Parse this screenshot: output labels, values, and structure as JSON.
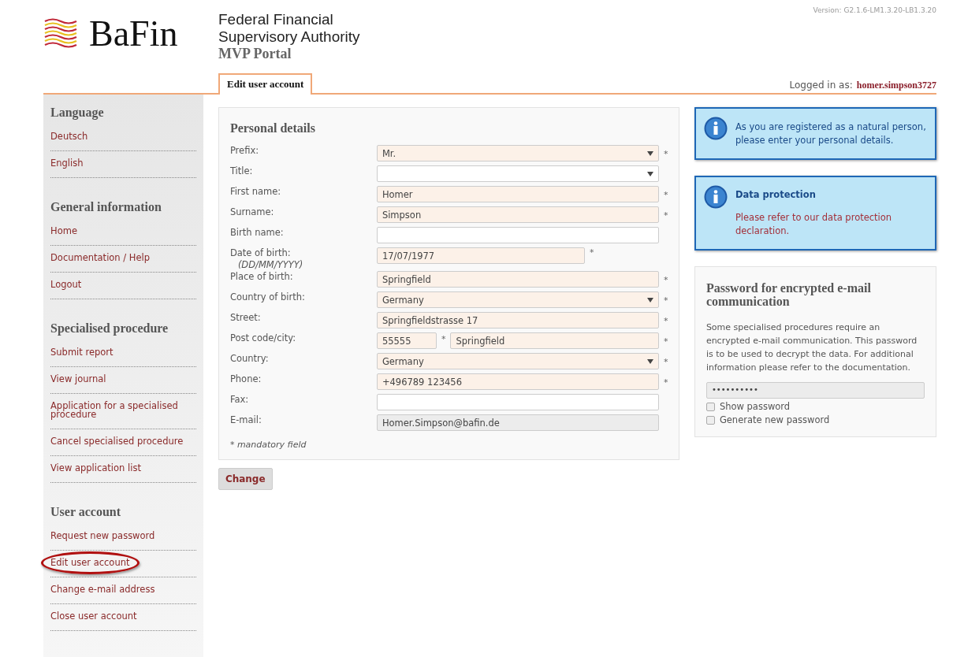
{
  "header": {
    "brand": "BaFin",
    "org_lines": [
      "Federal Financial",
      "Supervisory Authority"
    ],
    "portal": "MVP Portal",
    "version": "Version: G2.1.6-LM1.3.20-LB1.3.20",
    "tab": "Edit user account",
    "logged_in_label": "Logged in as:",
    "username": "homer.simpson3727"
  },
  "sidebar": [
    {
      "heading": "Language",
      "items": [
        {
          "label": "Deutsch",
          "circled": false
        },
        {
          "label": "English",
          "circled": false
        }
      ]
    },
    {
      "heading": "General information",
      "items": [
        {
          "label": "Home",
          "circled": false
        },
        {
          "label": "Documentation / Help",
          "circled": false
        },
        {
          "label": "Logout",
          "circled": false
        }
      ]
    },
    {
      "heading": "Specialised procedure",
      "items": [
        {
          "label": "Submit report",
          "circled": false
        },
        {
          "label": "View journal",
          "circled": false
        },
        {
          "label": "Application for a specialised procedure",
          "circled": false
        },
        {
          "label": "Cancel specialised procedure",
          "circled": false
        },
        {
          "label": "View application list",
          "circled": false
        }
      ]
    },
    {
      "heading": "User account",
      "items": [
        {
          "label": "Request new password",
          "circled": false
        },
        {
          "label": "Edit user account",
          "circled": true
        },
        {
          "label": "Change e-mail address",
          "circled": false
        },
        {
          "label": "Close user account",
          "circled": false
        }
      ]
    }
  ],
  "form": {
    "title": "Personal details",
    "fields": [
      {
        "label": "Prefix:",
        "kind": "select",
        "value": "Mr.",
        "required": true
      },
      {
        "label": "Title:",
        "kind": "select",
        "required": false
      },
      {
        "label": "First name:",
        "kind": "text",
        "value": "Homer",
        "required": true
      },
      {
        "label": "Surname:",
        "kind": "text",
        "value": "Simpson",
        "required": true
      },
      {
        "label": "Birth name:",
        "kind": "text",
        "required": false
      },
      {
        "label": "Date of birth:",
        "kind": "date",
        "value": "17/07/1977",
        "hint": "(DD/MM/YYYY)",
        "required": true
      },
      {
        "label": "Place of birth:",
        "kind": "text",
        "value": "Springfield",
        "required": true
      },
      {
        "label": "Country of birth:",
        "kind": "select",
        "value": "Germany",
        "required": true
      },
      {
        "label": "Street:",
        "kind": "text",
        "value": "Springfieldstrasse 17",
        "required": true
      },
      {
        "label": "Post code/city:",
        "kind": "split",
        "value": "55555",
        "value_2": "Springfield",
        "required": true
      },
      {
        "label": "Country:",
        "kind": "select",
        "value": "Germany",
        "required": true
      },
      {
        "label": "Phone:",
        "kind": "text",
        "value": "+496789 123456",
        "required": true
      },
      {
        "label": "Fax:",
        "kind": "text",
        "required": false
      },
      {
        "label": "E-mail:",
        "kind": "readonly",
        "value": "Homer.Simpson@bafin.de",
        "required": false
      }
    ],
    "required_mark": "*",
    "mandatory_note": "* *mandatory field*",
    "submit": "Change"
  },
  "notices": [
    {
      "text": "As you are registered as a natural person, please enter your personal details."
    },
    {
      "title": "Data protection",
      "text": "Please refer to our data protection declaration."
    }
  ],
  "password_panel": {
    "title": "Password for encrypted e-mail communication",
    "text": "Some specialised procedures require an encrypted e-mail communication. This password is to be used to decrypt the data. For additional information please refer to the documentation.",
    "value": "••••••••••",
    "options": [
      {
        "label": "Show password",
        "checked": false
      },
      {
        "label": "Generate new password",
        "checked": false
      }
    ]
  }
}
